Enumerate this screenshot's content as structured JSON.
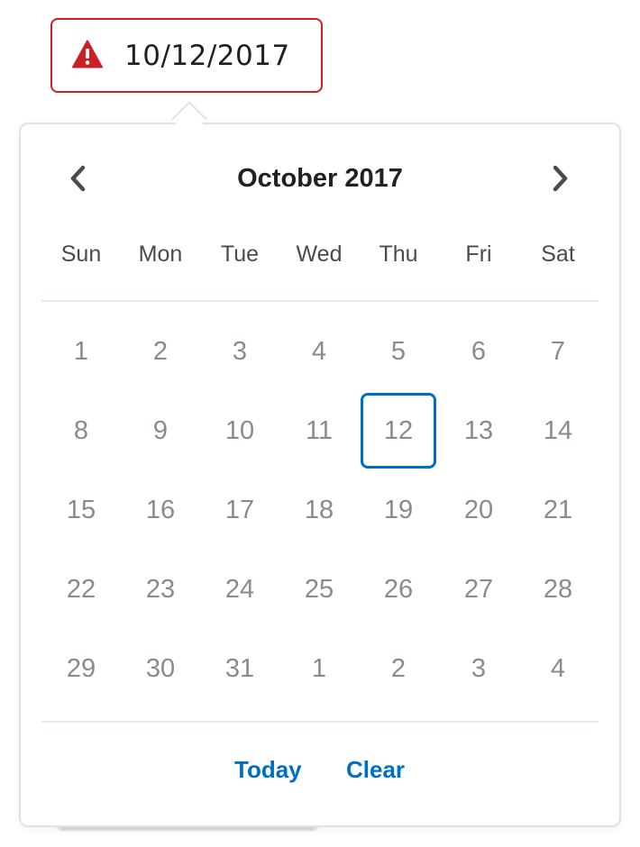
{
  "input": {
    "value": "10/12/2017",
    "state": "error"
  },
  "calendar": {
    "title": "October 2017",
    "weekdays": [
      "Sun",
      "Mon",
      "Tue",
      "Wed",
      "Thu",
      "Fri",
      "Sat"
    ],
    "weeks": [
      [
        "1",
        "2",
        "3",
        "4",
        "5",
        "6",
        "7"
      ],
      [
        "8",
        "9",
        "10",
        "11",
        "12",
        "13",
        "14"
      ],
      [
        "15",
        "16",
        "17",
        "18",
        "19",
        "20",
        "21"
      ],
      [
        "22",
        "23",
        "24",
        "25",
        "26",
        "27",
        "28"
      ],
      [
        "29",
        "30",
        "31",
        "1",
        "2",
        "3",
        "4"
      ]
    ],
    "selected_day": "12",
    "prev_icon": "chevron-left-icon",
    "next_icon": "chevron-right-icon"
  },
  "footer": {
    "today_label": "Today",
    "clear_label": "Clear"
  },
  "colors": {
    "error": "#cd2026",
    "accent": "#006fbf",
    "text_primary": "#202122",
    "day_text": "#868c8f",
    "divider": "#e3e9f1"
  }
}
